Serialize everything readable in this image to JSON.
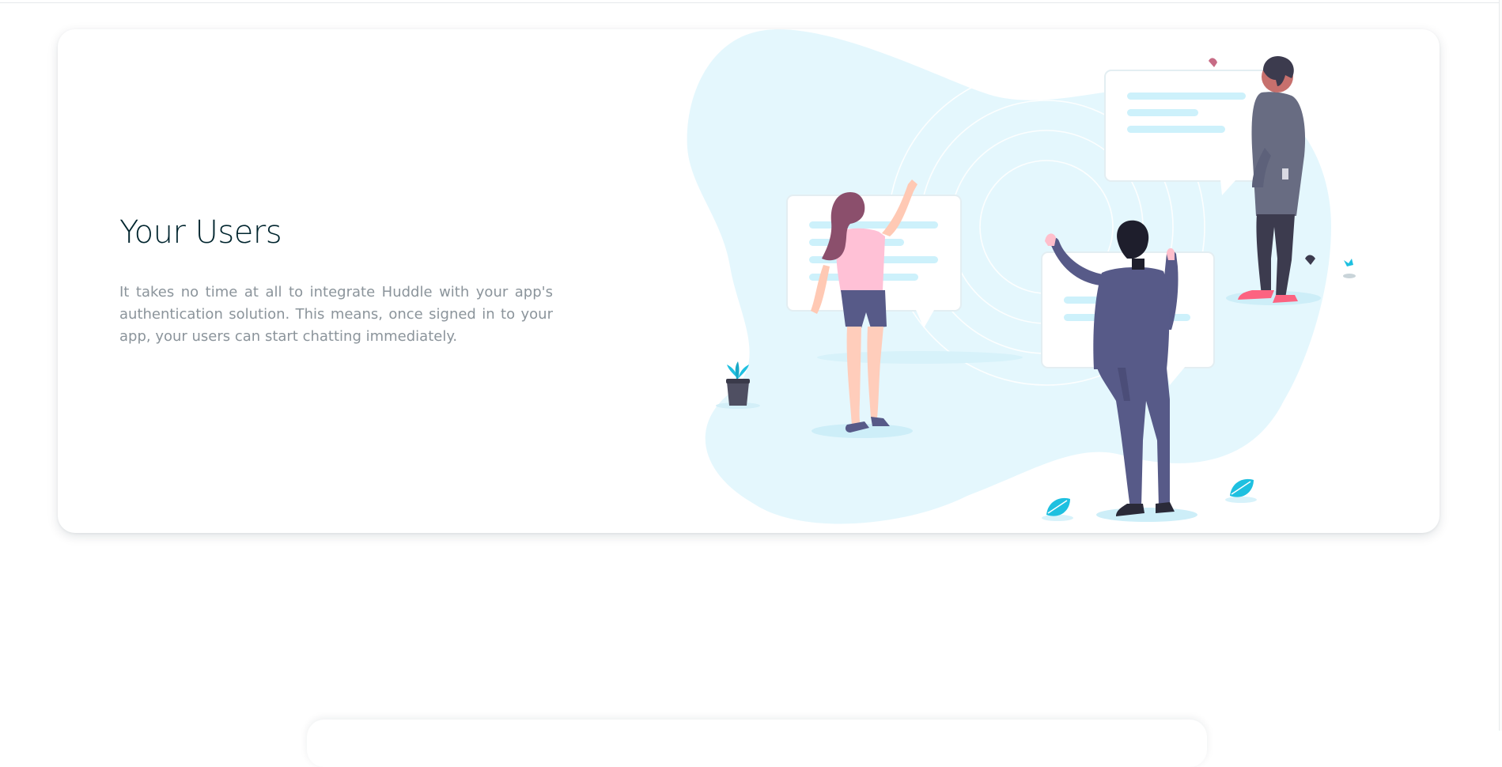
{
  "feature": {
    "title": "Your Users",
    "description": "It takes no time at all to integrate Huddle with your app's authentication solution. This means, once signed in to your app, your users can start chatting immediately."
  },
  "illustration": {
    "icon": "users-chatting-illustration"
  },
  "colors": {
    "accent_blob": "#e4f7fd",
    "title": "#00252e",
    "body_text": "#8b949b",
    "leaf": "#1ec0e0"
  }
}
